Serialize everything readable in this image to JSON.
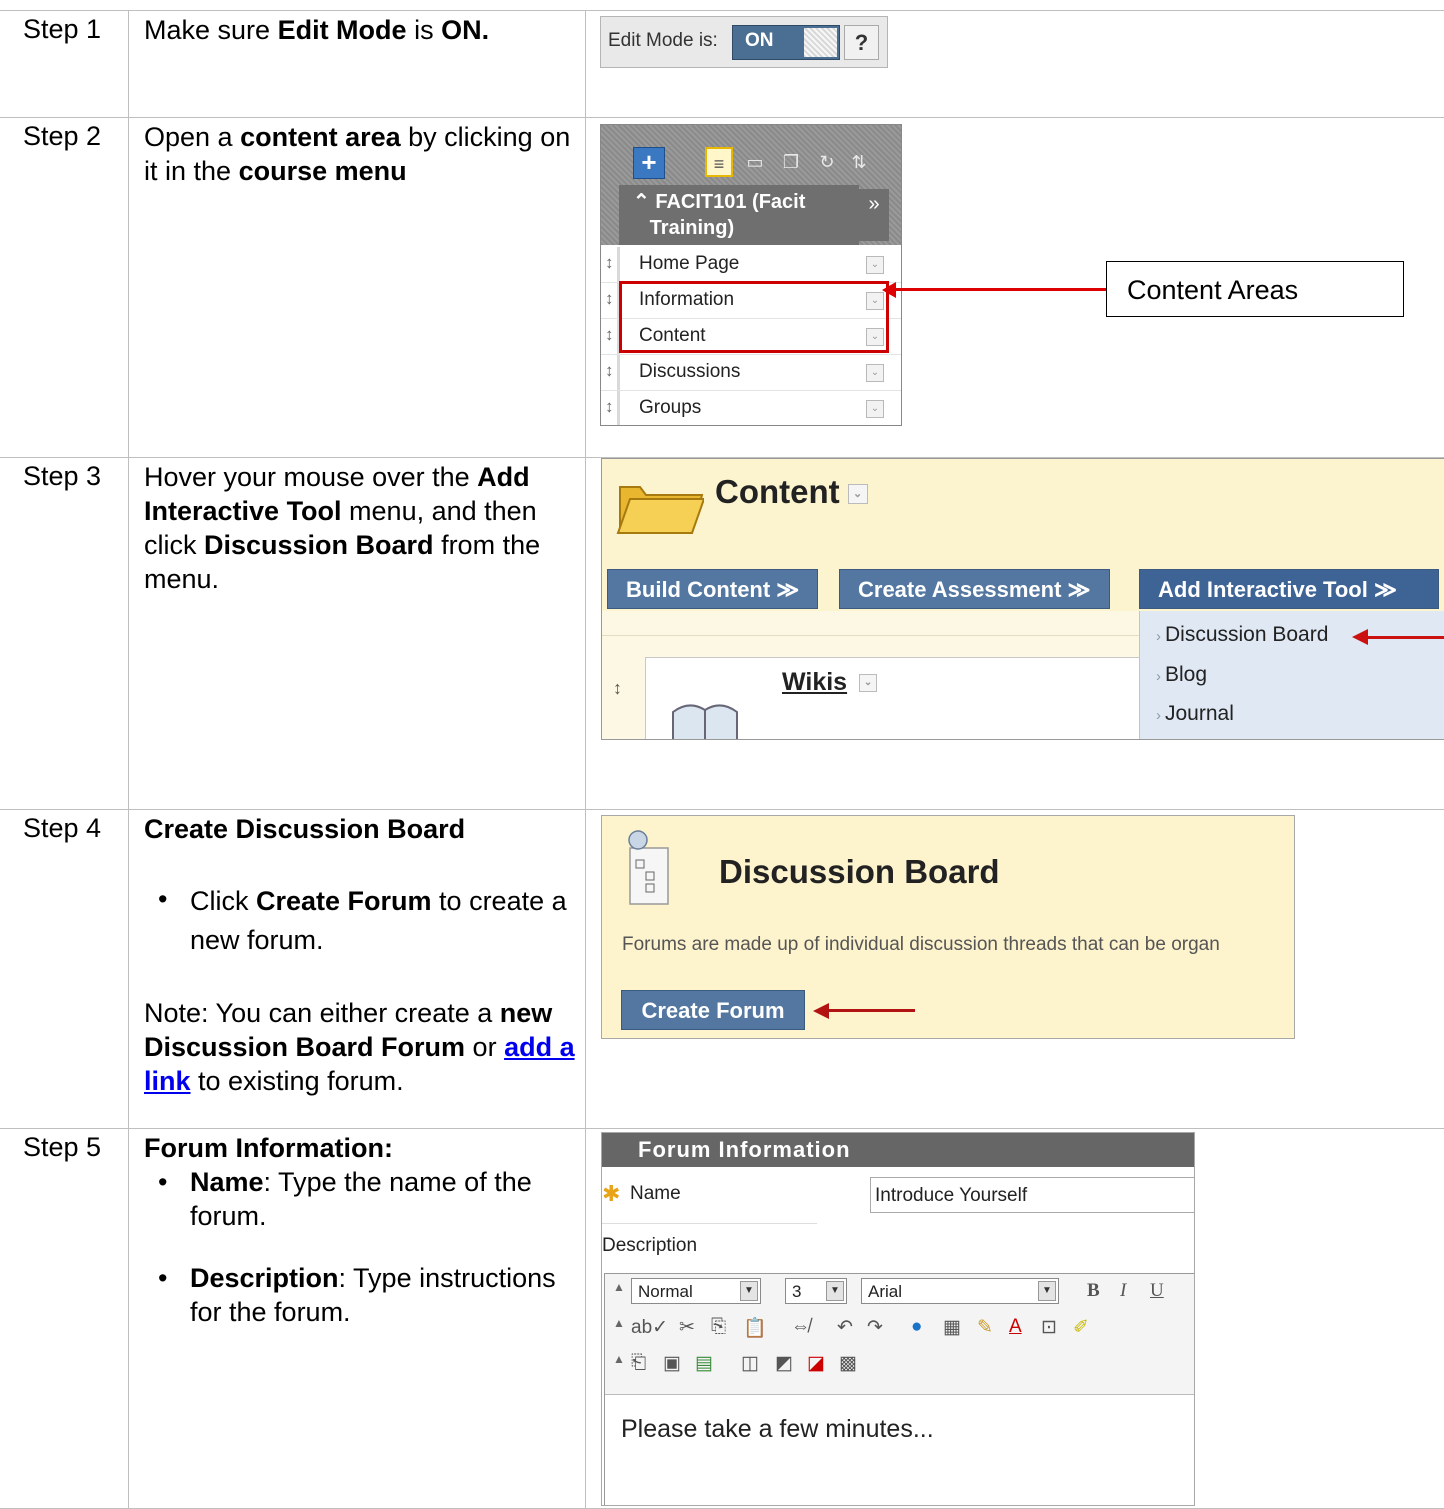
{
  "steps": [
    {
      "label": "Step 1"
    },
    {
      "label": "Step 2"
    },
    {
      "label": "Step 3"
    },
    {
      "label": "Step 4"
    },
    {
      "label": "Step 5"
    }
  ],
  "step1": {
    "t1": "Make sure ",
    "b1": "Edit Mode",
    "t2": " is ",
    "b2": "ON.",
    "shot": {
      "label": "Edit Mode is:",
      "toggle": "ON",
      "help": "?"
    }
  },
  "step2": {
    "t1": "Open a ",
    "b1": "content area",
    "t2": " by clicking on it in the ",
    "b2": "course menu",
    "shot": {
      "plus": "+",
      "course_title_1": "FACIT101 (Facit",
      "course_title_2": "Training)",
      "expand": "»",
      "items": [
        "Home Page",
        "Information",
        "Content",
        "Discussions",
        "Groups"
      ]
    },
    "callout": "Content Areas"
  },
  "step3": {
    "t1": "Hover your mouse over the  ",
    "b1": "Add Interactive Tool",
    "t2": " menu, and then click ",
    "b2": "Discussion Board",
    "t3": " from the menu.",
    "shot": {
      "title": "Content",
      "buttons": [
        "Build Content ≫",
        "Create Assessment ≫",
        "Add Interactive Tool ≫"
      ],
      "menu": [
        "Discussion Board",
        "Blog",
        "Journal"
      ],
      "item": "Wikis"
    }
  },
  "step4": {
    "heading": "Create Discussion Board",
    "bullet_t1": "Click ",
    "bullet_b1": "Create Forum",
    "bullet_t2": " to create a new forum.",
    "note_t1": "Note: You can either create a ",
    "note_b1": "new Discussion Board Forum",
    "note_t2": " or ",
    "note_link": "add a link",
    "note_t3": " to existing forum.",
    "shot": {
      "title": "Discussion Board",
      "desc": "Forums are made up of individual discussion threads that can be organ",
      "button": "Create Forum"
    }
  },
  "step5": {
    "heading": "Forum Information:",
    "b1": "Name",
    "t1": ": Type the name of the forum.",
    "b2": "Description",
    "t2": ": Type instructions for the forum.",
    "shot": {
      "header": "Forum Information",
      "name_label": "Name",
      "name_value": "Introduce Yourself",
      "desc_label": "Description",
      "format": "Normal",
      "size": "3",
      "font": "Arial",
      "body": "Please take a few minutes..."
    }
  },
  "colors": {
    "highlight": "#cc0000",
    "button": "#5377a0",
    "panel": "#fcf4cf",
    "link": "#0000ee"
  }
}
